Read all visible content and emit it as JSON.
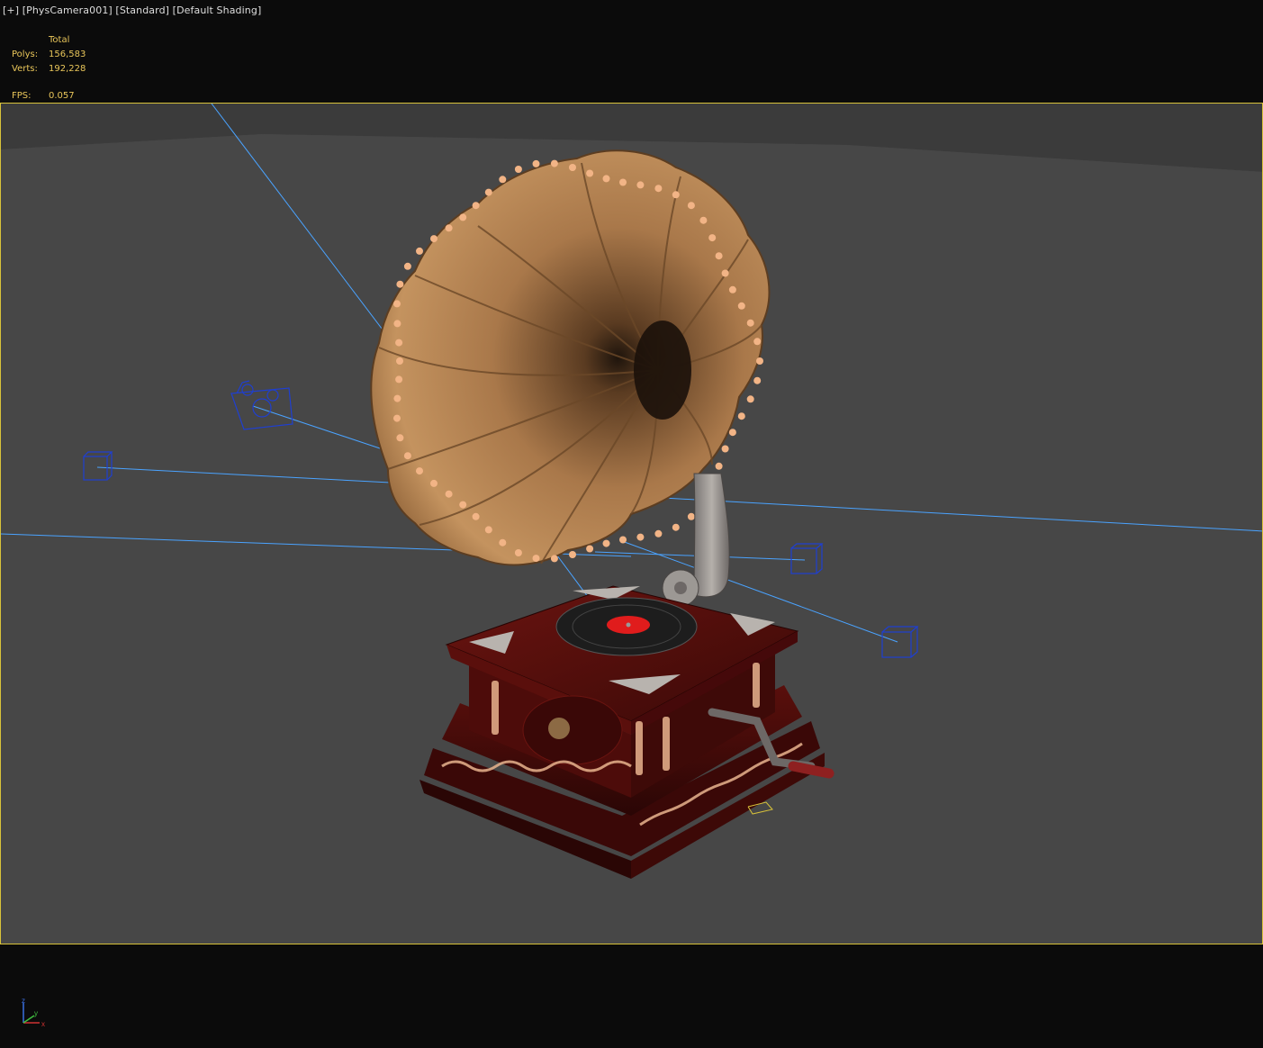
{
  "viewport_label": {
    "plus": "[+]",
    "camera": "[PhysCamera001]",
    "mode": "[Standard]",
    "shading": "[Default Shading]"
  },
  "stats": {
    "header": "Total",
    "polys_label": "Polys:",
    "polys_value": "156,583",
    "verts_label": "Verts:",
    "verts_value": "192,228",
    "fps_label": "FPS:",
    "fps_value": "0.057"
  },
  "axis": {
    "x": "x",
    "y": "y",
    "z": "z"
  },
  "colors": {
    "frame_border": "#d8c23a",
    "stats_text": "#e9c65a",
    "helper_lines": "#4aa3ff",
    "helper_boxes": "#1f3fd0",
    "viewport_bg": "#474747"
  },
  "objects": {
    "model": "gramophone",
    "helpers": [
      "light-box-icon",
      "light-box-icon",
      "light-box-icon",
      "camera-icon"
    ]
  }
}
